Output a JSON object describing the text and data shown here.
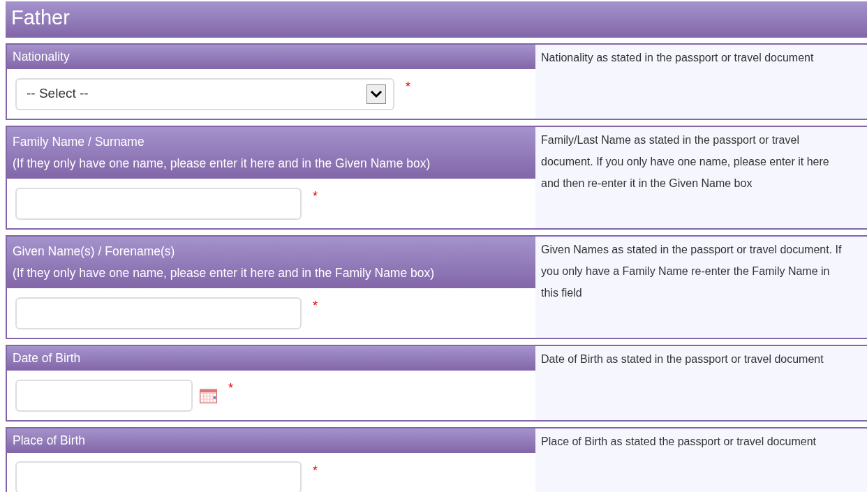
{
  "section_title": "Father",
  "fields": [
    {
      "kind": "select",
      "label": "Nationality",
      "value": "-- Select --",
      "required_mark": "*",
      "help": "Nationality as stated in the passport or travel document"
    },
    {
      "kind": "text",
      "label": "Family Name / Surname",
      "note": "(If they only have one name, please enter it here and in the Given Name box)",
      "required_mark": "*",
      "help": "Family/Last Name as stated in the passport or travel document. If you only have one name, please enter it here and then re-enter it in the Given Name box"
    },
    {
      "kind": "text",
      "label": "Given Name(s) / Forename(s)",
      "note": "(If they only have one name, please enter it here and in the Family Name box)",
      "required_mark": "*",
      "help": "Given Names as stated in the passport or travel document. If you only have a Family Name re-enter the Family Name in this field"
    },
    {
      "kind": "date",
      "label": "Date of Birth",
      "required_mark": "*",
      "help": "Date of Birth as stated in the passport or travel document"
    },
    {
      "kind": "text",
      "label": "Place of Birth",
      "required_mark": "*",
      "help": "Place of Birth as stated the passport or travel document"
    }
  ]
}
